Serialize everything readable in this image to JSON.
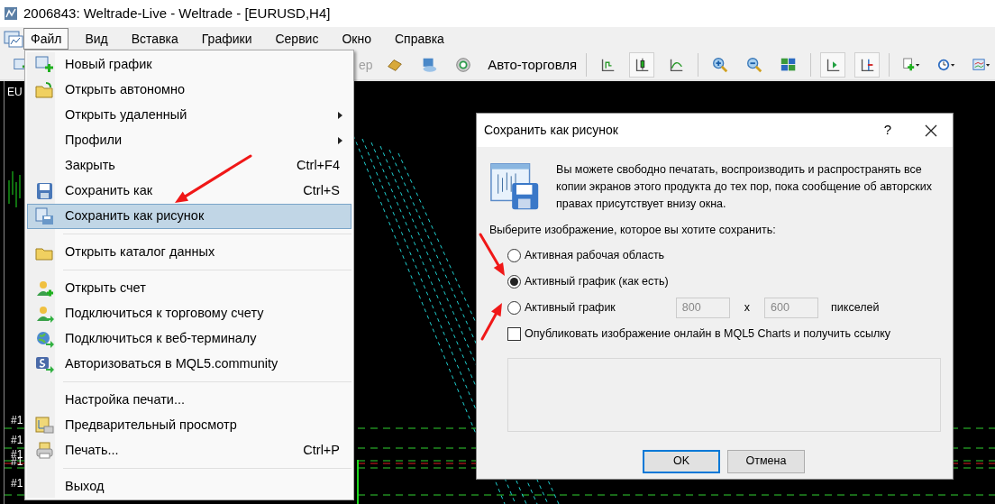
{
  "window": {
    "title": "2006843: Weltrade-Live - Weltrade - [EURUSD,H4]"
  },
  "menubar": [
    {
      "label": "Файл",
      "selected": true
    },
    {
      "label": "Вид",
      "selected": false
    },
    {
      "label": "Вставка",
      "selected": false
    },
    {
      "label": "Графики",
      "selected": false
    },
    {
      "label": "Сервис",
      "selected": false
    },
    {
      "label": "Окно",
      "selected": false
    },
    {
      "label": "Справка",
      "selected": false
    }
  ],
  "toolbar": {
    "cut_text": "ер",
    "auto_trading": "Авто-торговля",
    "toggles": [
      {
        "pressed": false
      },
      {
        "pressed": true
      },
      {
        "pressed": false
      },
      {
        "pressed": true
      },
      {
        "pressed": true
      }
    ]
  },
  "chart": {
    "symbol_label": "EU",
    "order_labels": [
      "#1",
      "#1",
      "#1",
      "#1",
      "#1"
    ]
  },
  "file_menu": [
    {
      "kind": "item",
      "label": "Новый график",
      "selected": false,
      "submenu": false
    },
    {
      "kind": "item",
      "label": "Открыть автономно",
      "selected": false,
      "submenu": false
    },
    {
      "kind": "item",
      "label": "Открыть удаленный",
      "selected": false,
      "submenu": true
    },
    {
      "kind": "item",
      "label": "Профили",
      "selected": false,
      "submenu": true
    },
    {
      "kind": "item",
      "label": "Закрыть",
      "shortcut": "Ctrl+F4",
      "selected": false,
      "submenu": false
    },
    {
      "kind": "item",
      "label": "Сохранить как",
      "shortcut": "Ctrl+S",
      "selected": false,
      "submenu": false
    },
    {
      "kind": "item",
      "label": "Сохранить как рисунок",
      "selected": true,
      "submenu": false
    },
    {
      "kind": "separator"
    },
    {
      "kind": "item",
      "label": "Открыть каталог данных",
      "selected": false,
      "submenu": false
    },
    {
      "kind": "separator"
    },
    {
      "kind": "item",
      "label": "Открыть счет",
      "selected": false,
      "submenu": false
    },
    {
      "kind": "item",
      "label": "Подключиться к торговому счету",
      "selected": false,
      "submenu": false
    },
    {
      "kind": "item",
      "label": "Подключиться к веб-терминалу",
      "selected": false,
      "submenu": false
    },
    {
      "kind": "item",
      "label": "Авторизоваться в MQL5.community",
      "selected": false,
      "submenu": false
    },
    {
      "kind": "separator"
    },
    {
      "kind": "item",
      "label": "Настройка печати...",
      "selected": false,
      "submenu": false
    },
    {
      "kind": "item",
      "label": "Предварительный просмотр",
      "selected": false,
      "submenu": false
    },
    {
      "kind": "item",
      "label": "Печать...",
      "shortcut": "Ctrl+P",
      "selected": false,
      "submenu": false
    },
    {
      "kind": "separator"
    },
    {
      "kind": "item",
      "label": "Выход",
      "selected": false,
      "submenu": false
    }
  ],
  "dialog": {
    "title": "Сохранить как рисунок",
    "help": "?",
    "message": "Вы можете свободно печатать, воспроизводить и распространять все копии экранов этого продукта до тех пор, пока сообщение об авторских правах присутствует внизу окна.",
    "prompt": "Выберите изображение, которое вы хотите сохранить:",
    "options": [
      {
        "label": "Активная рабочая область",
        "selected": false
      },
      {
        "label": "Активный график (как есть)",
        "selected": true
      },
      {
        "label": "Активный график",
        "selected": false
      }
    ],
    "width": {
      "value": "800",
      "disabled": true
    },
    "times": "x",
    "height": {
      "value": "600",
      "disabled": true
    },
    "unit": "пикселей",
    "publish": {
      "label": "Опубликовать изображение онлайн в MQL5 Charts и получить ссылку",
      "checked": false
    },
    "link_box": {
      "disabled": true
    },
    "buttons": [
      {
        "label": "OK",
        "default": true
      },
      {
        "label": "Отмена",
        "default": false
      }
    ]
  }
}
